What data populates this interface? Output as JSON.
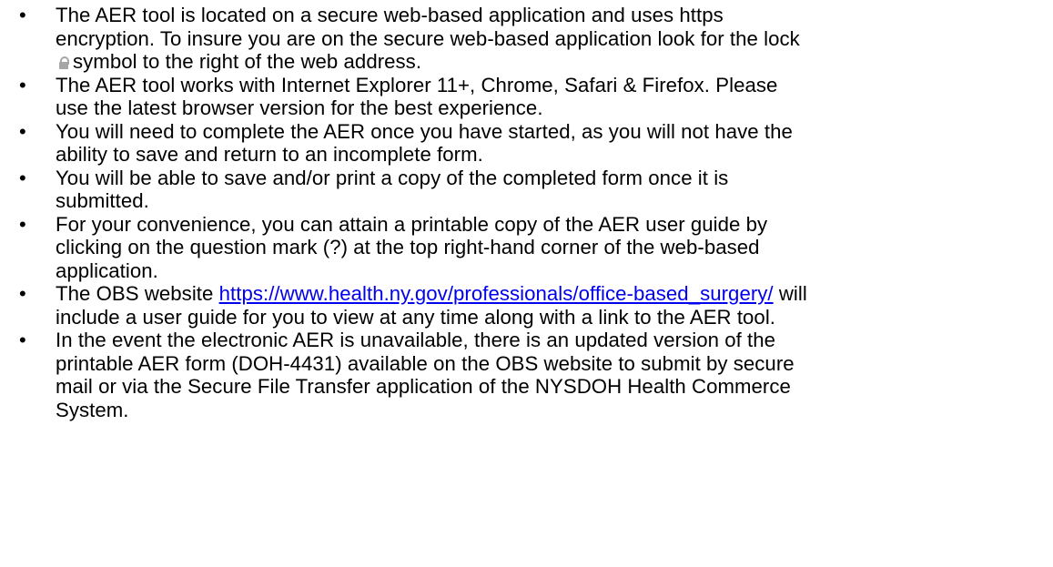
{
  "bullet_glyph": "•",
  "items": [
    {
      "line1": "The AER tool is located on a secure web-based application and uses https",
      "line2": "encryption.  To insure you are on the secure web-based application look for the lock",
      "line3_after_icon": "symbol to the right of the web address.",
      "icon": "lock-icon",
      "icon_color": "#a6a6a6"
    },
    {
      "line1": "The AER tool works with Internet Explorer 11+, Chrome, Safari & Firefox.  Please",
      "line2": "use the latest browser version for the best experience."
    },
    {
      "line1": "You will need to complete the AER once you have started, as you will not have the",
      "line2": "ability to save and return to an incomplete form."
    },
    {
      "line1": "You will be able to save and/or print a copy of the completed form once it is",
      "line2": "submitted."
    },
    {
      "line1": "For your convenience, you can attain a printable copy of the AER user guide by",
      "line2": "clicking on the question mark (?) at the top right-hand corner of the web-based",
      "line3": "application."
    },
    {
      "text_before_link": "The OBS website ",
      "link_text": "https://www.health.ny.gov/professionals/office-based_surgery/",
      "text_after_link": " will",
      "line2": "include a user guide for you to view at any time along with a link to the AER tool.",
      "link_color": "#0000ee"
    },
    {
      "line1": "In the event the electronic AER is unavailable, there is an updated version of the",
      "line2": "printable AER form (DOH-4431) available on the OBS website to submit by secure",
      "line3": "mail or via the Secure File Transfer application of the NYSDOH Health Commerce",
      "line4": "System."
    }
  ]
}
